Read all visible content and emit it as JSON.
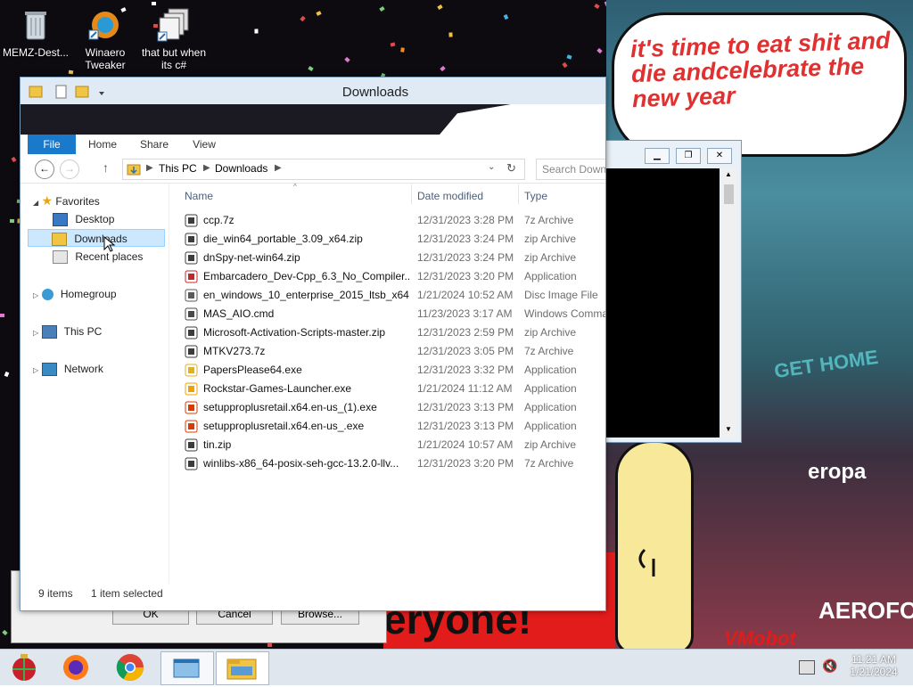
{
  "desktop": {
    "icons": [
      {
        "label": "MEMZ-Dest..."
      },
      {
        "label": "Winaero Tweaker"
      },
      {
        "label": "that but when its c#"
      }
    ],
    "bubble_text": "it's time to eat shit and die andcelebrate the new year",
    "banner_text": "eryone!",
    "sign_text_1": "GET HOME",
    "sign_text_2": "eropa",
    "sign_text_3": "AEROFOS",
    "watermark": "VMobot"
  },
  "background_dialog": {
    "ok_label": "OK",
    "cancel_label": "Cancel",
    "browse_label": "Browse..."
  },
  "explorer": {
    "title": "Downloads",
    "tabs": {
      "file": "File",
      "home": "Home",
      "share": "Share",
      "view": "View"
    },
    "address": {
      "segment1": "This PC",
      "segment2": "Downloads"
    },
    "search_placeholder": "Search Downloads",
    "nav": {
      "favorites": "Favorites",
      "desktop": "Desktop",
      "downloads": "Downloads",
      "recent": "Recent places",
      "homegroup": "Homegroup",
      "thispc": "This PC",
      "network": "Network"
    },
    "columns": {
      "name": "Name",
      "date": "Date modified",
      "type": "Type"
    },
    "files": [
      {
        "name": "ccp.7z",
        "date": "12/31/2023 3:28 PM",
        "type": "7z Archive",
        "icon": "archive-icon"
      },
      {
        "name": "die_win64_portable_3.09_x64.zip",
        "date": "12/31/2023 3:24 PM",
        "type": "zip Archive",
        "icon": "archive-icon"
      },
      {
        "name": "dnSpy-net-win64.zip",
        "date": "12/31/2023 3:24 PM",
        "type": "zip Archive",
        "icon": "archive-icon"
      },
      {
        "name": "Embarcadero_Dev-Cpp_6.3_No_Compiler...",
        "date": "12/31/2023 3:20 PM",
        "type": "Application",
        "icon": "devcpp-icon"
      },
      {
        "name": "en_windows_10_enterprise_2015_ltsb_x64...",
        "date": "1/21/2024 10:52 AM",
        "type": "Disc Image File",
        "icon": "disc-image-icon"
      },
      {
        "name": "MAS_AIO.cmd",
        "date": "11/23/2023 3:17 AM",
        "type": "Windows Comma",
        "icon": "cmd-icon"
      },
      {
        "name": "Microsoft-Activation-Scripts-master.zip",
        "date": "12/31/2023 2:59 PM",
        "type": "zip Archive",
        "icon": "archive-icon"
      },
      {
        "name": "MTKV273.7z",
        "date": "12/31/2023 3:05 PM",
        "type": "7z Archive",
        "icon": "archive-icon"
      },
      {
        "name": "PapersPlease64.exe",
        "date": "12/31/2023 3:32 PM",
        "type": "Application",
        "icon": "papers-please-icon"
      },
      {
        "name": "Rockstar-Games-Launcher.exe",
        "date": "1/21/2024 11:12 AM",
        "type": "Application",
        "icon": "rockstar-icon"
      },
      {
        "name": "setupproplusretail.x64.en-us_(1).exe",
        "date": "12/31/2023 3:13 PM",
        "type": "Application",
        "icon": "office-icon"
      },
      {
        "name": "setupproplusretail.x64.en-us_.exe",
        "date": "12/31/2023 3:13 PM",
        "type": "Application",
        "icon": "office-icon"
      },
      {
        "name": "tin.zip",
        "date": "1/21/2024 10:57 AM",
        "type": "zip Archive",
        "icon": "archive-icon"
      },
      {
        "name": "winlibs-x86_64-posix-seh-gcc-13.2.0-llv...",
        "date": "12/31/2023 3:20 PM",
        "type": "7z Archive",
        "icon": "archive-icon"
      }
    ],
    "status": {
      "items": "9 items",
      "selected": "1 item selected"
    }
  },
  "taskbar": {
    "clock_time": "11:21 AM",
    "clock_date": "1/21/2024"
  },
  "colors": {
    "accent": "#1979ca",
    "selection": "#cce8ff",
    "bubble_text": "#e0302f"
  }
}
